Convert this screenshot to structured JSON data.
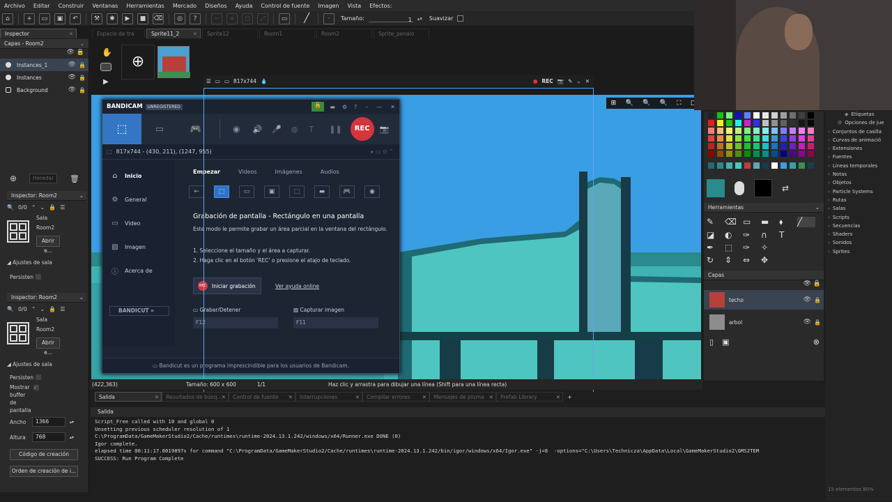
{
  "menu": {
    "items": [
      "Archivo",
      "Editar",
      "Construir",
      "Ventanas",
      "Herramientas",
      "Mercado",
      "Diseños",
      "Ayuda",
      "Control de fuente",
      "Imagen",
      "Vista",
      "Efectos:"
    ]
  },
  "toolbar": {
    "size_label": "Tamaño:",
    "size_value": "1",
    "smooth_label": "Suavizar"
  },
  "tabs": {
    "items": [
      {
        "label": "Inspector",
        "active": true
      },
      {
        "label": "Espacio de tra",
        "active": false
      },
      {
        "label": "Sprite11_2",
        "active": true
      },
      {
        "label": "Sprite12",
        "active": false
      },
      {
        "label": "Room1",
        "active": false
      },
      {
        "label": "Room2",
        "active": false
      },
      {
        "label": "Sprite_penalo",
        "active": false
      }
    ]
  },
  "layers_panel": {
    "header": "Capas - Room2",
    "layers": [
      "Instances_1",
      "Instances",
      "Background"
    ],
    "add_label": "Heredar"
  },
  "inspector1": {
    "header": "Inspector: Room2",
    "count": "0/0",
    "sala_label": "Sala",
    "room_name": "Room2",
    "open_btn": "Abrir e...",
    "settings_header": "Ajustes de sala",
    "persistent": "Persisten"
  },
  "inspector2": {
    "header": "Inspector: Room2",
    "count": "0/0",
    "sala_label": "Sala",
    "room_name": "Room2",
    "open_btn": "Abrir e...",
    "settings_header": "Ajustes de sala",
    "persistent": "Persisten",
    "show_buffer": "Mostrar buffer de pantalla",
    "width_label": "Ancho",
    "width_value": "1366",
    "height_label": "Altura",
    "height_value": "768",
    "creation_code_btn": "Código de creación",
    "creation_order_btn": "Orden de creación de i..."
  },
  "sprite_editor": {
    "dimensions": "817x744"
  },
  "status": {
    "coords": "(422,363)",
    "size": "Tamaño: 600 x 600",
    "frame": "1/1",
    "hint": "Haz clic y arrastra para dibujar una línea (Shift para una línea recta)"
  },
  "output": {
    "tabs": [
      "Salida",
      "Resultados de búsq...",
      "Control de fuente",
      "Interrupciones",
      "Compilar errores",
      "Mensajes de pluma",
      "Prefab Library"
    ],
    "subheader": "Salida",
    "lines": [
      "Script_Free called with 10 and global 0",
      "Unsetting previous scheduler resolution of 1",
      "",
      "",
      "C:\\ProgramData/GameMakerStudio2/Cache/runtimes\\runtime-2024.13.1.242/windows/x64/Runner.exe DONE (0)",
      "Igor complete.",
      "elapsed time 00:11:17.0019897s for command \"C:\\ProgramData/GameMakerStudio2/Cache/runtimes\\runtime-2024.13.1.242/bin/igor/windows/x64/Igor.exe\" -j=8  -options=\"C:\\Users\\Technicza\\AppData\\Local\\GameMakerStudio2\\GMS2TEM",
      "SUCCESS: Run Program Complete"
    ]
  },
  "right_panel": {
    "tools_header": "Herramientas",
    "layers_header": "Capas",
    "layers": [
      "techo",
      "arbol"
    ]
  },
  "assets": {
    "items": [
      "Etiquetas",
      "Opciones de jue",
      "Conjuntos de casilla",
      "Curvas de animació",
      "Extensiones",
      "Fuentes",
      "Líneas temporales",
      "Notas",
      "Objetos",
      "Particle Systems",
      "Rutas",
      "Salas",
      "Scripts",
      "Secuencias",
      "Shaders",
      "Sonidos",
      "Sprites"
    ],
    "footer": "15 elementos 80%"
  },
  "bandicam": {
    "brand": "BANDICAM",
    "edition": "UNREGISTERED",
    "rec_label": "REC",
    "region": "817x744 - (430, 211), (1247, 955)",
    "nav": [
      "Inicio",
      "General",
      "Video",
      "Imagen",
      "Acerca de"
    ],
    "tabs": [
      "Empezar",
      "Videos",
      "Imágenes",
      "Audios"
    ],
    "title": "Grabación de pantalla - Rectángulo en una pantalla",
    "desc": "Este modo le permite grabar un área parcial en la ventana del rectángulo.",
    "step1": "1. Seleccione el tamaño y el área a capturar.",
    "step2": "2. Haga clic en el botón 'REC' o presione el atajo de teclado.",
    "start_btn": "Iniciar grabación",
    "help_link": "Ver ayuda online",
    "hk1_label": "Grabar/Detener",
    "hk1_value": "F12",
    "hk2_label": "Capturar imagen",
    "hk2_value": "F11",
    "bandicut": "BANDICUT",
    "footer": "Bandicut es un programa imprescindible para los usuarios de Bandicam.",
    "rec_icon_text": "REC"
  },
  "palette_colors": [
    "#101010",
    "#ff2020",
    "#20c020",
    "#2040ff",
    "#ffff20",
    "#20ffff",
    "#ff20ff",
    "#ffffff"
  ]
}
